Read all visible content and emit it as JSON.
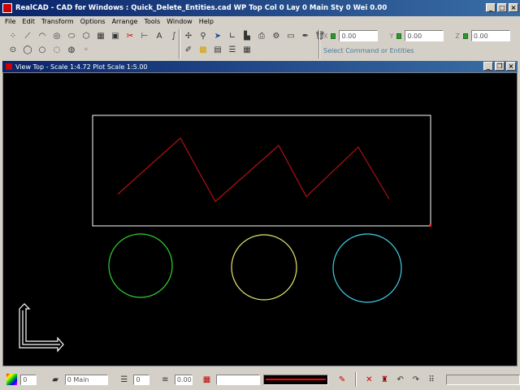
{
  "window": {
    "title": "RealCAD - CAD for Windows : Quick_Delete_Entities.cad   WP Top   Col 0 Lay 0 Main Sty 0 Wei 0.00",
    "minimize_icon": "minimize-icon",
    "maximize_icon": "maximize-icon",
    "close_icon": "close-icon"
  },
  "menu": [
    "File",
    "Edit",
    "Transform",
    "Options",
    "Arrange",
    "Tools",
    "Window",
    "Help"
  ],
  "coords": {
    "x_label": "X",
    "x_value": "0.00",
    "y_label": "Y",
    "y_value": "0.00",
    "z_label": "Z",
    "z_value": "0.00",
    "command_prompt": "Select Command or Entities"
  },
  "drawing_window": {
    "title": "View Top - Scale 1:4.72 Plot Scale 1:5.00",
    "background": "#000000"
  },
  "drawing": {
    "rect_color": "#ffffff",
    "zigzag_color": "#b01010",
    "circle_colors": [
      "#2fd42f",
      "#e6e66a",
      "#3fd2e8"
    ],
    "marker_color": "#ff2020",
    "axis_color": "#ffffff"
  },
  "status": {
    "color_value": "0",
    "layer_value": "0 Main",
    "style_value": "0",
    "weight_value": "0.00",
    "line_preview_color": "#ff0000"
  }
}
